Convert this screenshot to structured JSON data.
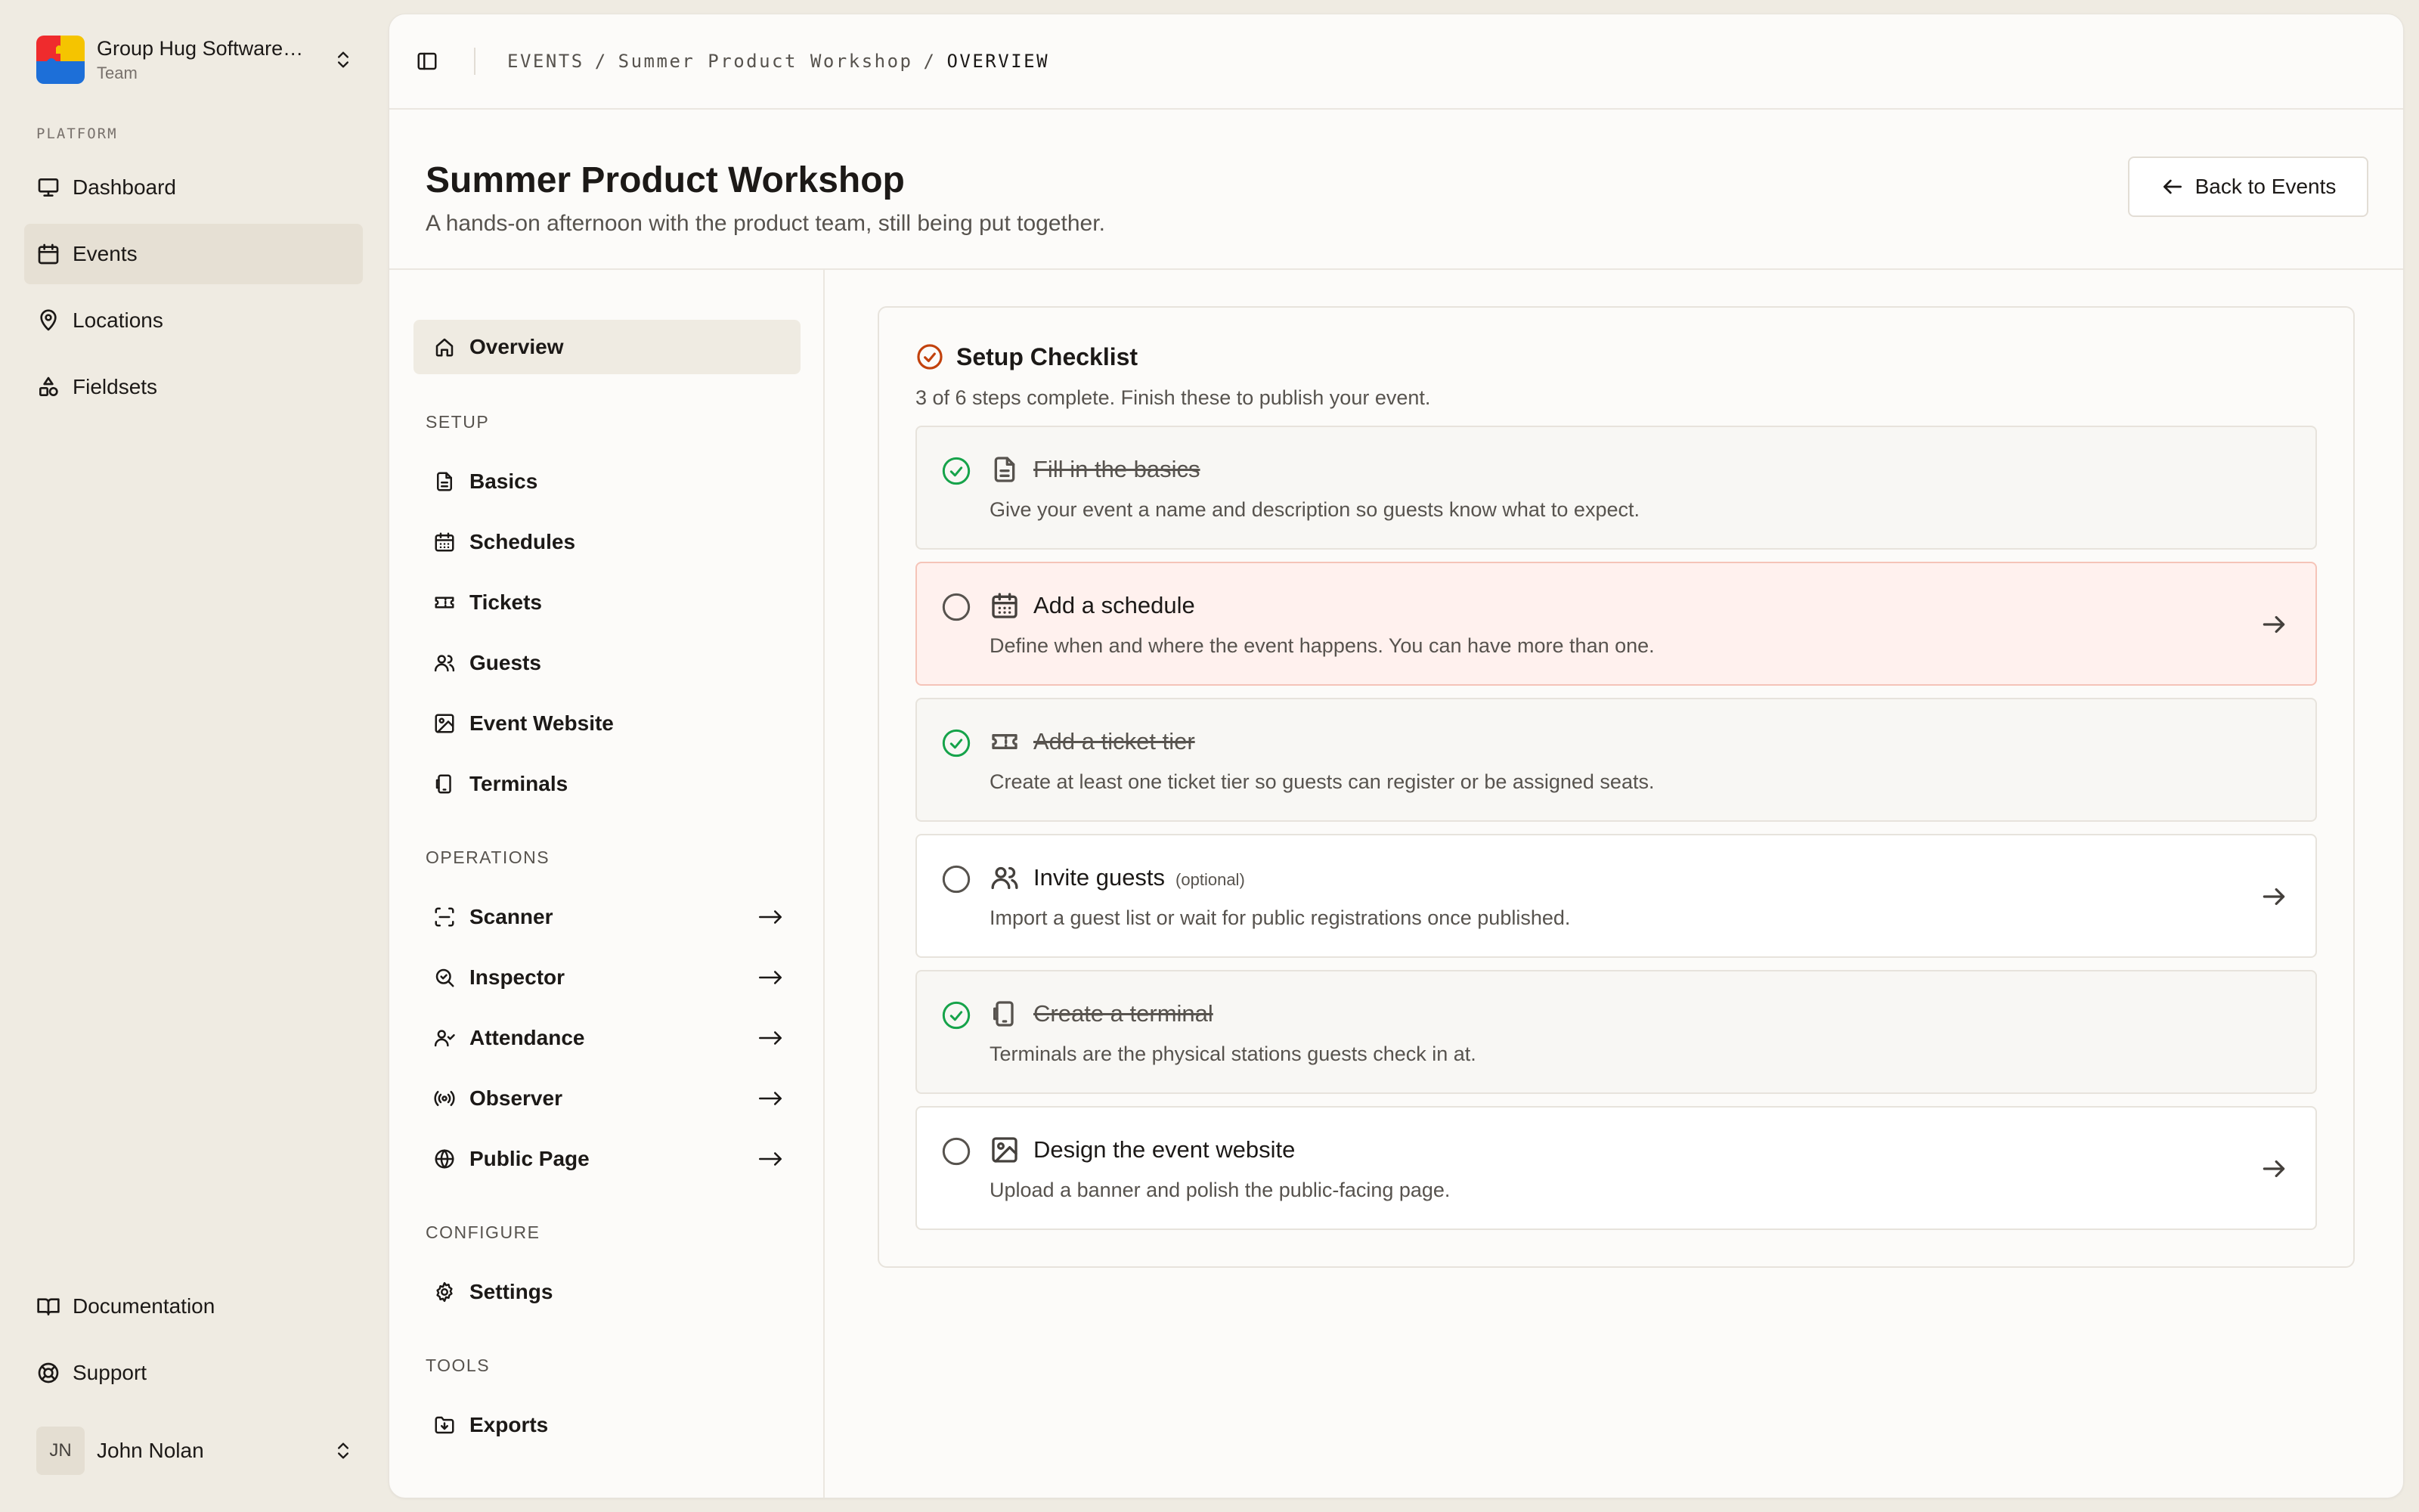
{
  "app": {
    "team": {
      "name": "Group Hug Software…",
      "role": "Team"
    },
    "platform_label": "PLATFORM",
    "nav": [
      {
        "label": "Dashboard",
        "icon": "monitor-icon"
      },
      {
        "label": "Events",
        "icon": "calendar-icon",
        "active": true
      },
      {
        "label": "Locations",
        "icon": "map-pin-icon"
      },
      {
        "label": "Fieldsets",
        "icon": "shapes-icon"
      }
    ],
    "footer_nav": [
      {
        "label": "Documentation",
        "icon": "book-icon"
      },
      {
        "label": "Support",
        "icon": "life-buoy-icon"
      }
    ],
    "user": {
      "initials": "JN",
      "name": "John Nolan"
    }
  },
  "breadcrumb": {
    "root": "EVENTS",
    "event": "Summer Product Workshop",
    "current": "OVERVIEW",
    "sep": "/"
  },
  "page": {
    "title": "Summer Product Workshop",
    "subtitle": "A hands-on afternoon with the product team, still being put together.",
    "back_label": "Back to Events"
  },
  "subnav": {
    "overview": "Overview",
    "groups": {
      "setup": "SETUP",
      "operations": "OPERATIONS",
      "configure": "CONFIGURE",
      "tools": "TOOLS"
    },
    "setup": [
      "Basics",
      "Schedules",
      "Tickets",
      "Guests",
      "Event Website",
      "Terminals"
    ],
    "operations": [
      "Scanner",
      "Inspector",
      "Attendance",
      "Observer",
      "Public Page"
    ],
    "configure": [
      "Settings"
    ],
    "tools": [
      "Exports"
    ]
  },
  "checklist": {
    "title": "Setup Checklist",
    "summary": "3 of 6 steps complete. Finish these to publish your event.",
    "steps": [
      {
        "title": "Fill in the basics",
        "desc": "Give your event a name and description so guests know what to expect.",
        "done": true,
        "icon": "file-text-icon"
      },
      {
        "title": "Add a schedule",
        "desc": "Define when and where the event happens. You can have more than one.",
        "done": false,
        "icon": "calendar-icon"
      },
      {
        "title": "Add a ticket tier",
        "desc": "Create at least one ticket tier so guests can register or be assigned seats.",
        "done": true,
        "icon": "ticket-icon"
      },
      {
        "title": "Invite guests",
        "optional": "(optional)",
        "desc": "Import a guest list or wait for public registrations once published.",
        "done": false,
        "icon": "users-icon"
      },
      {
        "title": "Create a terminal",
        "desc": "Terminals are the physical stations guests check in at.",
        "done": true,
        "icon": "terminal-device-icon"
      },
      {
        "title": "Design the event website",
        "desc": "Upload a banner and polish the public-facing page.",
        "done": false,
        "icon": "image-icon"
      }
    ]
  },
  "colors": {
    "accent": "#c2410c",
    "done": "#16a34a",
    "current_bg": "#fff1ee"
  }
}
